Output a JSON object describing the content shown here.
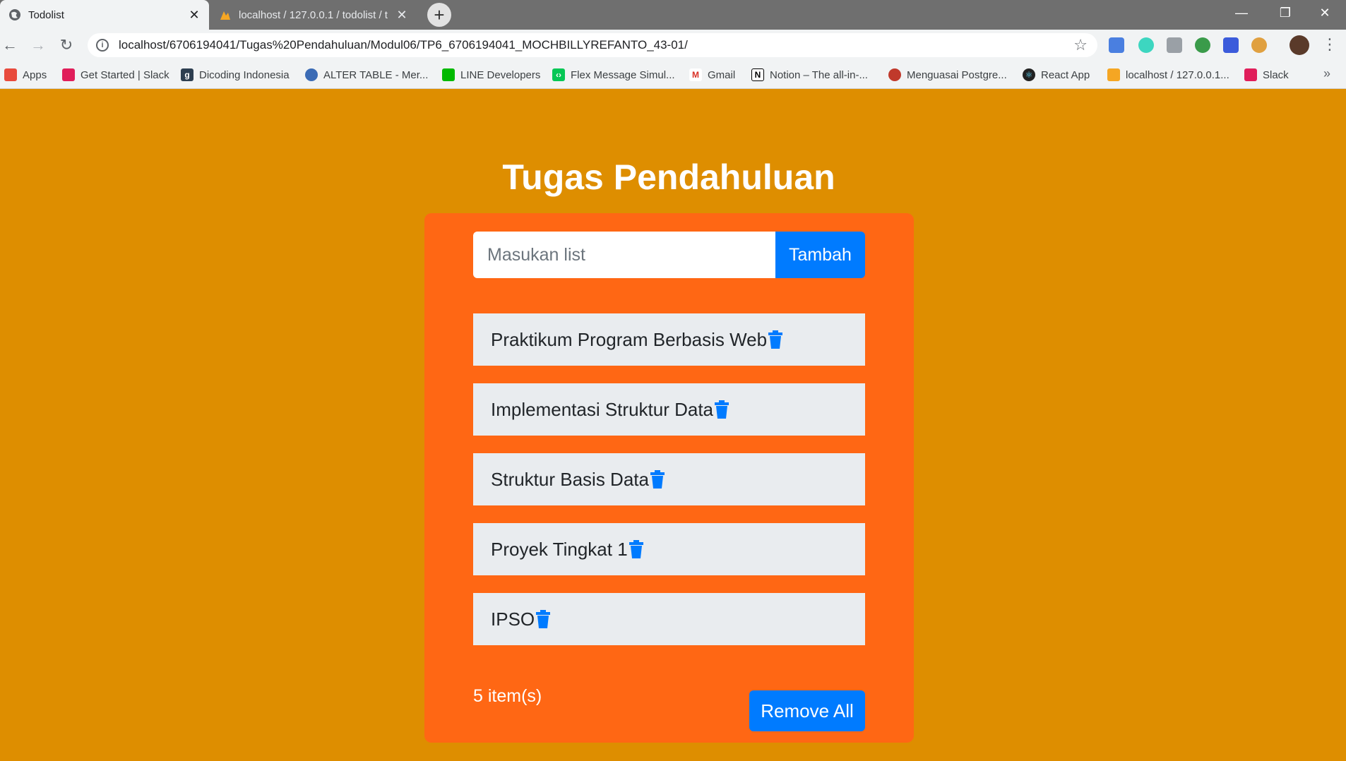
{
  "browser": {
    "tabs": [
      {
        "title": "Todolist",
        "active": true
      },
      {
        "title": "localhost / 127.0.0.1 / todolist / t",
        "active": false
      }
    ],
    "url": "localhost/6706194041/Tugas%20Pendahuluan/Modul06/TP6_6706194041_MOCHBILLYREFANTO_43-01/",
    "bookmarks": [
      {
        "label": "Apps",
        "icon": "apps-grid-icon"
      },
      {
        "label": "Get Started | Slack",
        "icon": "slack-icon"
      },
      {
        "label": "Dicoding Indonesia",
        "icon": "dicoding-icon"
      },
      {
        "label": "ALTER TABLE - Mer...",
        "icon": "globe-icon"
      },
      {
        "label": "LINE Developers",
        "icon": "line-icon"
      },
      {
        "label": "Flex Message Simul...",
        "icon": "code-icon"
      },
      {
        "label": "Gmail",
        "icon": "gmail-icon"
      },
      {
        "label": "Notion – The all-in-...",
        "icon": "notion-icon"
      },
      {
        "label": "Menguasai Postgre...",
        "icon": "leaf-icon"
      },
      {
        "label": "React App",
        "icon": "react-icon"
      },
      {
        "label": "localhost / 127.0.0.1...",
        "icon": "phpmyadmin-icon"
      },
      {
        "label": "Slack",
        "icon": "slack-icon"
      }
    ],
    "bookmarks_more": "»"
  },
  "page": {
    "title": "Tugas Pendahuluan",
    "input": {
      "placeholder": "Masukan list",
      "value": ""
    },
    "add_button": "Tambah",
    "todos": [
      "Praktikum Program Berbasis Web",
      "Implementasi Struktur Data",
      "Struktur Basis Data",
      "Proyek Tingkat 1",
      "IPSO"
    ],
    "count": "5 item(s)",
    "remove_all_button": "Remove All"
  },
  "colors": {
    "background": "#DE8E00",
    "card": "#FF6714",
    "button": "#007BFF",
    "item_bg": "#E9ECEF"
  }
}
